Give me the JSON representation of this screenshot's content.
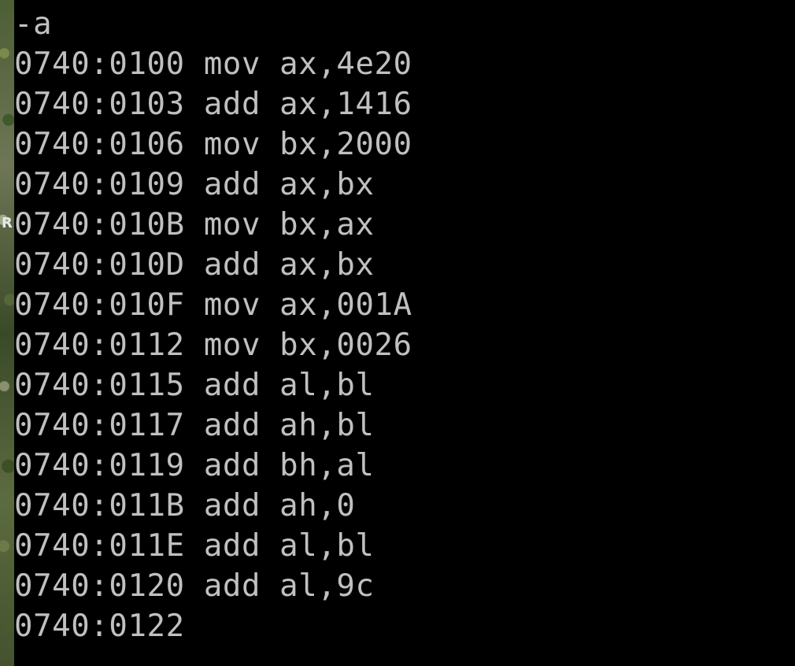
{
  "side_letter": "R",
  "prompt": "-a",
  "lines": [
    {
      "address": "0740:0100",
      "instruction": "mov ax,4e20"
    },
    {
      "address": "0740:0103",
      "instruction": "add ax,1416"
    },
    {
      "address": "0740:0106",
      "instruction": "mov bx,2000"
    },
    {
      "address": "0740:0109",
      "instruction": "add ax,bx"
    },
    {
      "address": "0740:010B",
      "instruction": "mov bx,ax"
    },
    {
      "address": "0740:010D",
      "instruction": "add ax,bx"
    },
    {
      "address": "0740:010F",
      "instruction": "mov ax,001A"
    },
    {
      "address": "0740:0112",
      "instruction": "mov bx,0026"
    },
    {
      "address": "0740:0115",
      "instruction": "add al,bl"
    },
    {
      "address": "0740:0117",
      "instruction": "add ah,bl"
    },
    {
      "address": "0740:0119",
      "instruction": "add bh,al"
    },
    {
      "address": "0740:011B",
      "instruction": "add ah,0"
    },
    {
      "address": "0740:011E",
      "instruction": "add al,bl"
    },
    {
      "address": "0740:0120",
      "instruction": "add al,9c"
    },
    {
      "address": "0740:0122",
      "instruction": ""
    }
  ]
}
